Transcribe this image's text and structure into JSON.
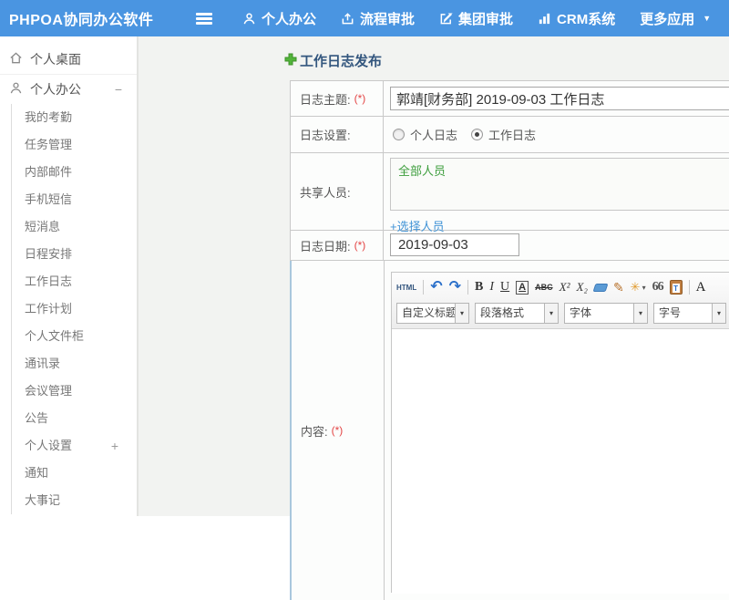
{
  "header": {
    "app_title": "PHPOA协同办公软件",
    "nav": [
      {
        "label": "个人办公",
        "icon": "user-icon"
      },
      {
        "label": "流程审批",
        "icon": "upload-icon"
      },
      {
        "label": "集团审批",
        "icon": "edit-icon"
      },
      {
        "label": "CRM系统",
        "icon": "bar-chart-icon"
      },
      {
        "label": "更多应用",
        "icon": "caret-down-icon",
        "caret": "▼"
      }
    ]
  },
  "sidebar": {
    "desktop_label": "个人桌面",
    "office_label": "个人办公",
    "office_toggle": "−",
    "submenu": [
      {
        "label": "我的考勤"
      },
      {
        "label": "任务管理"
      },
      {
        "label": "内部邮件"
      },
      {
        "label": "手机短信"
      },
      {
        "label": "短消息"
      },
      {
        "label": "日程安排"
      },
      {
        "label": "工作日志"
      },
      {
        "label": "工作计划"
      },
      {
        "label": "个人文件柜"
      },
      {
        "label": "通讯录"
      },
      {
        "label": "会议管理"
      },
      {
        "label": "公告"
      },
      {
        "label": "个人设置",
        "toggle": "+"
      },
      {
        "label": "通知"
      },
      {
        "label": "大事记"
      }
    ]
  },
  "form": {
    "page_title": "工作日志发布",
    "subject": {
      "label": "日志主题:",
      "required": "(*)",
      "value": "郭靖[财务部] 2019-09-03 工作日志"
    },
    "setting": {
      "label": "日志设置:",
      "options": [
        {
          "label": "个人日志",
          "checked": false
        },
        {
          "label": "工作日志",
          "checked": true
        }
      ]
    },
    "share": {
      "label": "共享人员:",
      "value": "全部人员",
      "link_label": "+选择人员"
    },
    "date": {
      "label": "日志日期:",
      "required": "(*)",
      "value": "2019-09-03"
    },
    "content": {
      "label": "内容:",
      "required": "(*)"
    }
  },
  "editor": {
    "toolbar": {
      "html_label": "HTML",
      "undo": "↶",
      "redo": "↷",
      "bold": "B",
      "italic": "I",
      "underline": "U",
      "font_color": "A",
      "strike": "ABC",
      "superscript": "X²",
      "subscript": "X₂",
      "brush": "✎",
      "wand": "✳",
      "wand_caret": "▾",
      "quote": "66",
      "paste_t": "T",
      "letter_a": "A",
      "dd_caret": "▾"
    },
    "dropdowns": [
      {
        "label": "自定义标题"
      },
      {
        "label": "段落格式"
      },
      {
        "label": "字体"
      },
      {
        "label": "字号"
      }
    ]
  },
  "colors": {
    "header_bg": "#4a95e1",
    "accent_green": "#52b43a",
    "link_blue": "#4193d6",
    "required_red": "#e34444",
    "title_blue": "#33567e"
  }
}
